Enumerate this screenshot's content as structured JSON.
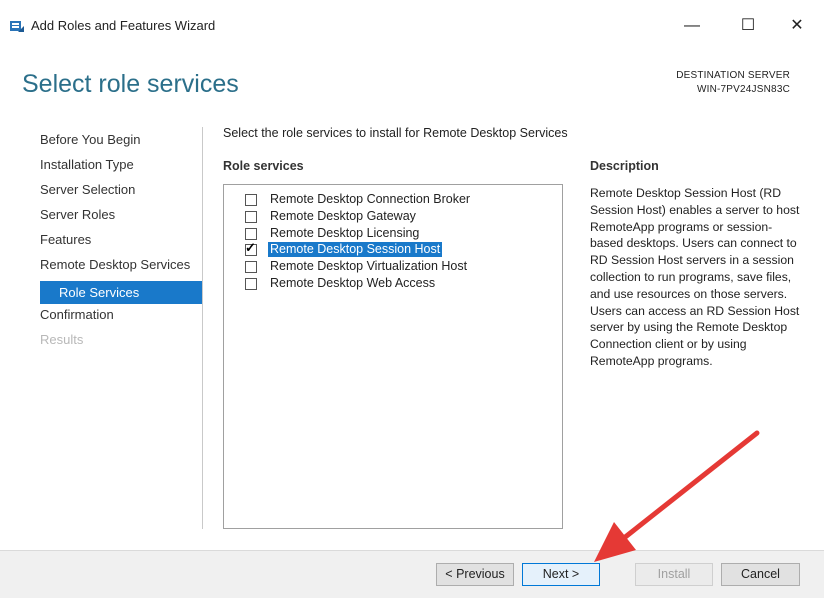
{
  "window": {
    "title": "Add Roles and Features Wizard",
    "minimize": "—",
    "maximize": "☐",
    "close": "✕"
  },
  "header": {
    "page_title": "Select role services",
    "destination_label": "DESTINATION SERVER",
    "destination_server": "WIN-7PV24JSN83C"
  },
  "nav": {
    "items": [
      {
        "label": "Before You Begin"
      },
      {
        "label": "Installation Type"
      },
      {
        "label": "Server Selection"
      },
      {
        "label": "Server Roles"
      },
      {
        "label": "Features"
      },
      {
        "label": "Remote Desktop Services"
      },
      {
        "label": "Role Services"
      },
      {
        "label": "Confirmation"
      },
      {
        "label": "Results"
      }
    ]
  },
  "main": {
    "instruction": "Select the role services to install for Remote Desktop Services",
    "role_services_heading": "Role services",
    "roles": [
      {
        "label": "Remote Desktop Connection Broker",
        "checked": false
      },
      {
        "label": "Remote Desktop Gateway",
        "checked": false
      },
      {
        "label": "Remote Desktop Licensing",
        "checked": false
      },
      {
        "label": "Remote Desktop Session Host",
        "checked": true
      },
      {
        "label": "Remote Desktop Virtualization Host",
        "checked": false
      },
      {
        "label": "Remote Desktop Web Access",
        "checked": false
      }
    ],
    "description_heading": "Description",
    "description_text": "Remote Desktop Session Host (RD Session Host) enables a server to host RemoteApp programs or session-based desktops. Users can connect to RD Session Host servers in a session collection to run programs, save files, and use resources on those servers. Users can access an RD Session Host server by using the Remote Desktop Connection client or by using RemoteApp programs."
  },
  "footer": {
    "previous": "< Previous",
    "next": "Next >",
    "install": "Install",
    "cancel": "Cancel"
  },
  "colors": {
    "accent": "#1979ca",
    "title": "#2b6f8a",
    "annotation_arrow": "#e53935"
  }
}
